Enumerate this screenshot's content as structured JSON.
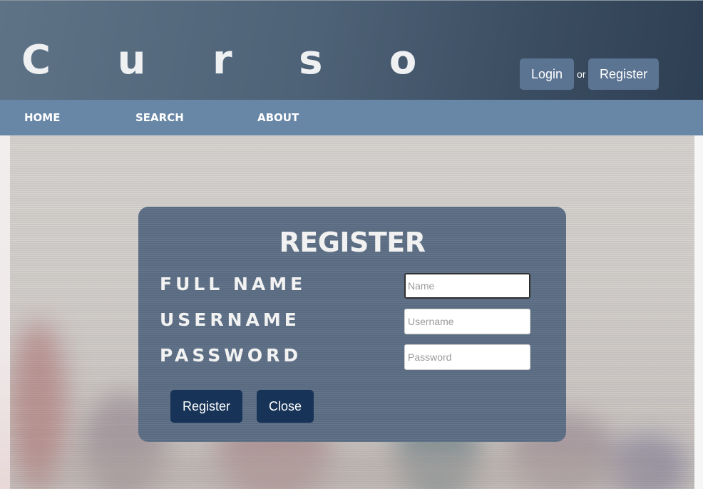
{
  "header": {
    "brand": "C u r s o",
    "login_label": "Login",
    "or_label": "or",
    "register_label": "Register"
  },
  "nav": {
    "items": [
      {
        "label": "HOME"
      },
      {
        "label": "SEARCH"
      },
      {
        "label": "ABOUT"
      }
    ]
  },
  "modal": {
    "title": "REGISTER",
    "fields": [
      {
        "label": "FULL NAME",
        "placeholder": "Name",
        "value": ""
      },
      {
        "label": "USERNAME",
        "placeholder": "Username",
        "value": ""
      },
      {
        "label": "PASSWORD",
        "placeholder": "Password",
        "value": ""
      }
    ],
    "register_button": "Register",
    "close_button": "Close"
  },
  "colors": {
    "header_bg": "#4e6277",
    "nav_bg": "#6886a6",
    "modal_bg": "#5d6f86",
    "modal_button_bg": "#173357",
    "auth_button_bg": "#5b7492"
  }
}
